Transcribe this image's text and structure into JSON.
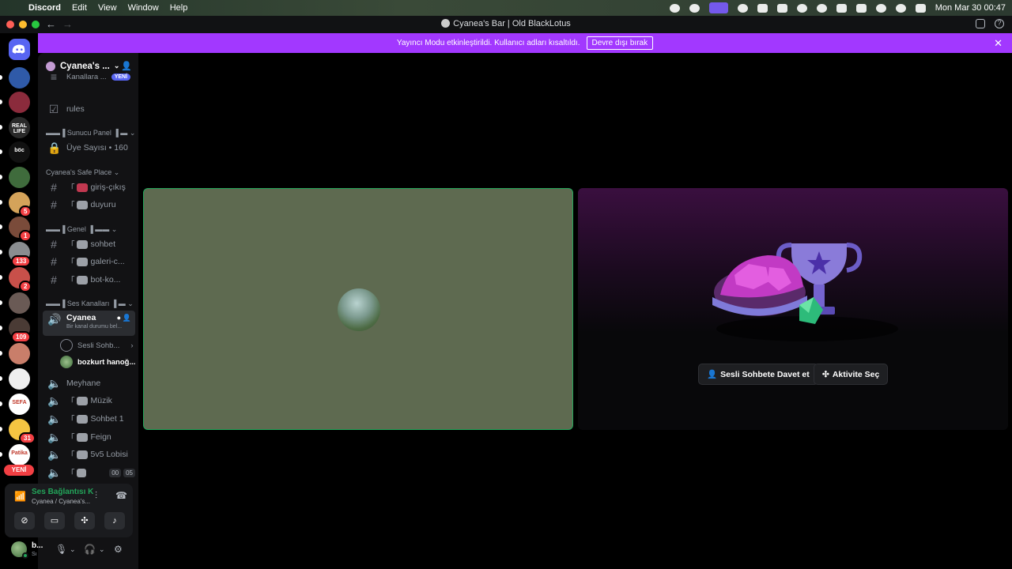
{
  "menubar": {
    "app": "Discord",
    "items": [
      "Edit",
      "View",
      "Window",
      "Help"
    ],
    "clock": "Mon Mar 30  00:47"
  },
  "window": {
    "title": "Cyanea's Bar | Old BlackLotus"
  },
  "notice": {
    "text": "Yayıncı Modu etkinleştirildi. Kullanıcı adları kısaltıldı.",
    "button": "Devre dışı bırak"
  },
  "guilds": {
    "items": [
      {
        "name": "server-1",
        "badge": "",
        "color": "#2f5aa8"
      },
      {
        "name": "server-2",
        "badge": "",
        "color": "#8b2b3c"
      },
      {
        "name": "server-3",
        "badge": "",
        "color": "#2a2a2a",
        "text": "REAL LIFE"
      },
      {
        "name": "server-4",
        "badge": "",
        "color": "#111",
        "text": "böc"
      },
      {
        "name": "server-5",
        "badge": "",
        "color": "#3f6b3c"
      },
      {
        "name": "server-6",
        "badge": "5",
        "color": "#d4a35a"
      },
      {
        "name": "server-7",
        "badge": "1",
        "color": "#7a4b3a"
      },
      {
        "name": "server-8",
        "badge": "133",
        "color": "#8a8d90"
      },
      {
        "name": "server-9",
        "badge": "2",
        "color": "#c8504a"
      },
      {
        "name": "server-10",
        "badge": "",
        "color": "#6a5a55"
      },
      {
        "name": "server-11",
        "badge": "109",
        "color": "#4a3b35"
      },
      {
        "name": "server-12",
        "badge": "",
        "color": "#c97e6a"
      },
      {
        "name": "server-13",
        "badge": "",
        "color": "#eeeeee"
      },
      {
        "name": "server-14",
        "badge": "",
        "color": "#ffffff",
        "text": "SEFA"
      },
      {
        "name": "server-15",
        "badge": "31",
        "color": "#f5c542"
      },
      {
        "name": "server-16",
        "badge": "",
        "color": "#ffffff",
        "text": "Patika"
      }
    ],
    "new_label": "YENİ"
  },
  "sidebar": {
    "server_name": "Cyanea's ...",
    "top_channel": "Kanallara ...",
    "top_new": "YENİ",
    "rules": "rules",
    "cat_panel": "▬▬▐ Sunucu Panel ▐ ▬",
    "member_count": "Üye Sayısı • 160",
    "cat_safe": "Cyanea's Safe Place",
    "giris": "giriş-çıkış",
    "duyuru": "duyuru",
    "cat_genel": "▬▬▐ Genel ▐ ▬▬",
    "sohbet": "sohbet",
    "galeri": "galeri-c...",
    "botko": "bot-ko...",
    "cat_ses": "▬▬▐ Ses Kanalları ▐ ▬",
    "voice_active": "Cyanea",
    "voice_status": "Bir kanal durumu bel...",
    "sesli_sohbet": "Sesli Sohb...",
    "user1": "bozkurt hanoğ...",
    "meyhane": "Meyhane",
    "muzik": "Müzik",
    "sohbet1": "Sohbet 1",
    "feign": "Feign",
    "lobi": "5v5 Lobisi",
    "last_count_a": "00",
    "last_count_b": "05",
    "bracket": "「"
  },
  "voice_panel": {
    "status": "Ses Bağlantısı K",
    "sub": "Cyanea / Cyanea's..."
  },
  "user_bar": {
    "name": "b...",
    "status": "Sı"
  },
  "stage": {
    "invite_btn": "Sesli Sohbete Davet et",
    "activity_btn": "Aktivite Seç"
  }
}
